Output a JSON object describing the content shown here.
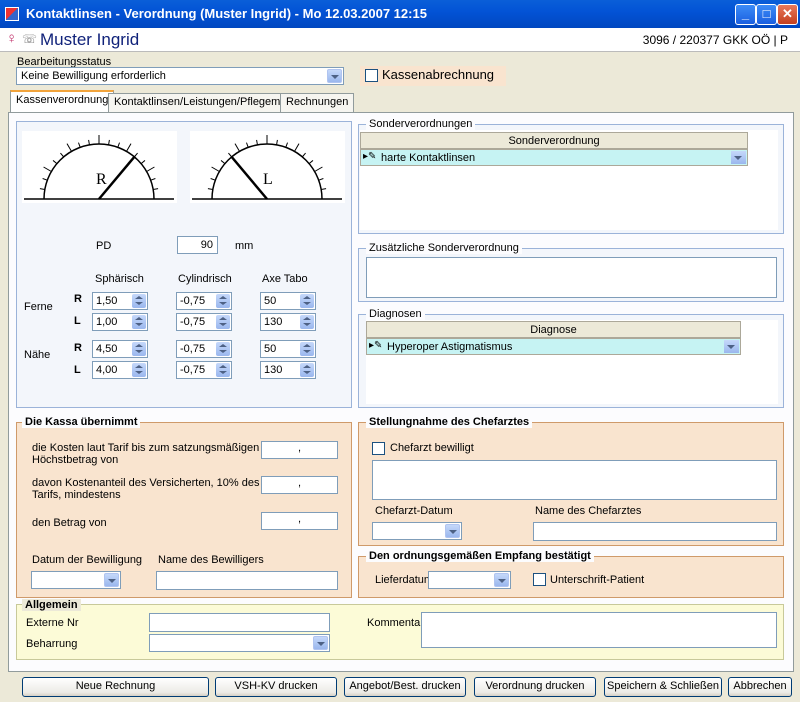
{
  "window": {
    "title": "Kontaktlinsen - Verordnung  (Muster Ingrid) - Mo 12.03.2007 12:15"
  },
  "patient": {
    "name": "Muster Ingrid",
    "id": "3096 / 220377 GKK OÖ | P"
  },
  "status": {
    "label": "Bearbeitungsstatus",
    "value": "Keine Bewilligung erforderlich",
    "kasse_label": "Kassenabrechnung"
  },
  "tabs": [
    "Kassenverordnung",
    "Kontaktlinsen/Leistungen/Pflegemittel",
    "Rechnungen"
  ],
  "gauges": {
    "right": "R",
    "left": "L"
  },
  "pd": {
    "label": "PD",
    "value": "90",
    "unit": "mm"
  },
  "refraction": {
    "col_headers": [
      "Sphärisch",
      "Cylindrisch",
      "Axe Tabo"
    ],
    "ferne_label": "Ferne",
    "naehe_label": "Nähe",
    "r": "R",
    "l": "L",
    "ferne_r": [
      "1,50",
      "-0,75",
      "50"
    ],
    "ferne_l": [
      "1,00",
      "-0,75",
      "130"
    ],
    "naehe_r": [
      "4,50",
      "-0,75",
      "50"
    ],
    "naehe_l": [
      "4,00",
      "-0,75",
      "130"
    ]
  },
  "sonder": {
    "title": "Sonderverordnungen",
    "col": "Sonderverordnung",
    "row": "harte Kontaktlinsen"
  },
  "zusatz": {
    "title": "Zusätzliche Sonderverordnung"
  },
  "diagnosen": {
    "title": "Diagnosen",
    "col": "Diagnose",
    "row": "Hyperoper Astigmatismus"
  },
  "kassa": {
    "title": "Die Kassa übernimmt",
    "line1a": "die Kosten laut Tarif bis zum satzungsmäßigen",
    "line1b": "Höchstbetrag von",
    "line2a": "davon Kostenanteil des Versicherten, 10% des",
    "line2b": "Tarifs, mindestens",
    "line3": "den Betrag von",
    "decimal": ",",
    "datum_label": "Datum der Bewilligung",
    "name_label": "Name des Bewilligers"
  },
  "chefarzt": {
    "title": "Stellungnahme des Chefarztes",
    "bewilligt": "Chefarzt bewilligt",
    "datum_label": "Chefarzt-Datum",
    "name_label": "Name des Chefarztes"
  },
  "empfang": {
    "title": "Den ordnungsgemäßen Empfang bestätigt",
    "lieferdatum": "Lieferdatum",
    "unterschrift": "Unterschrift-Patient"
  },
  "allgemein": {
    "title": "Allgemein",
    "externe": "Externe Nr",
    "beharrung": "Beharrung",
    "kommentar": "Kommentar"
  },
  "buttons": [
    "Neue Rechnung",
    "VSH-KV drucken",
    "Angebot/Best. drucken",
    "Verordnung drucken",
    "Speichern & Schließen",
    "Abbrechen"
  ],
  "colors": {
    "titlebar": "#0353d6",
    "peach": "#f9e4cf",
    "grid_row": "#c6f3f3",
    "allgemein": "#fcfbd7"
  }
}
